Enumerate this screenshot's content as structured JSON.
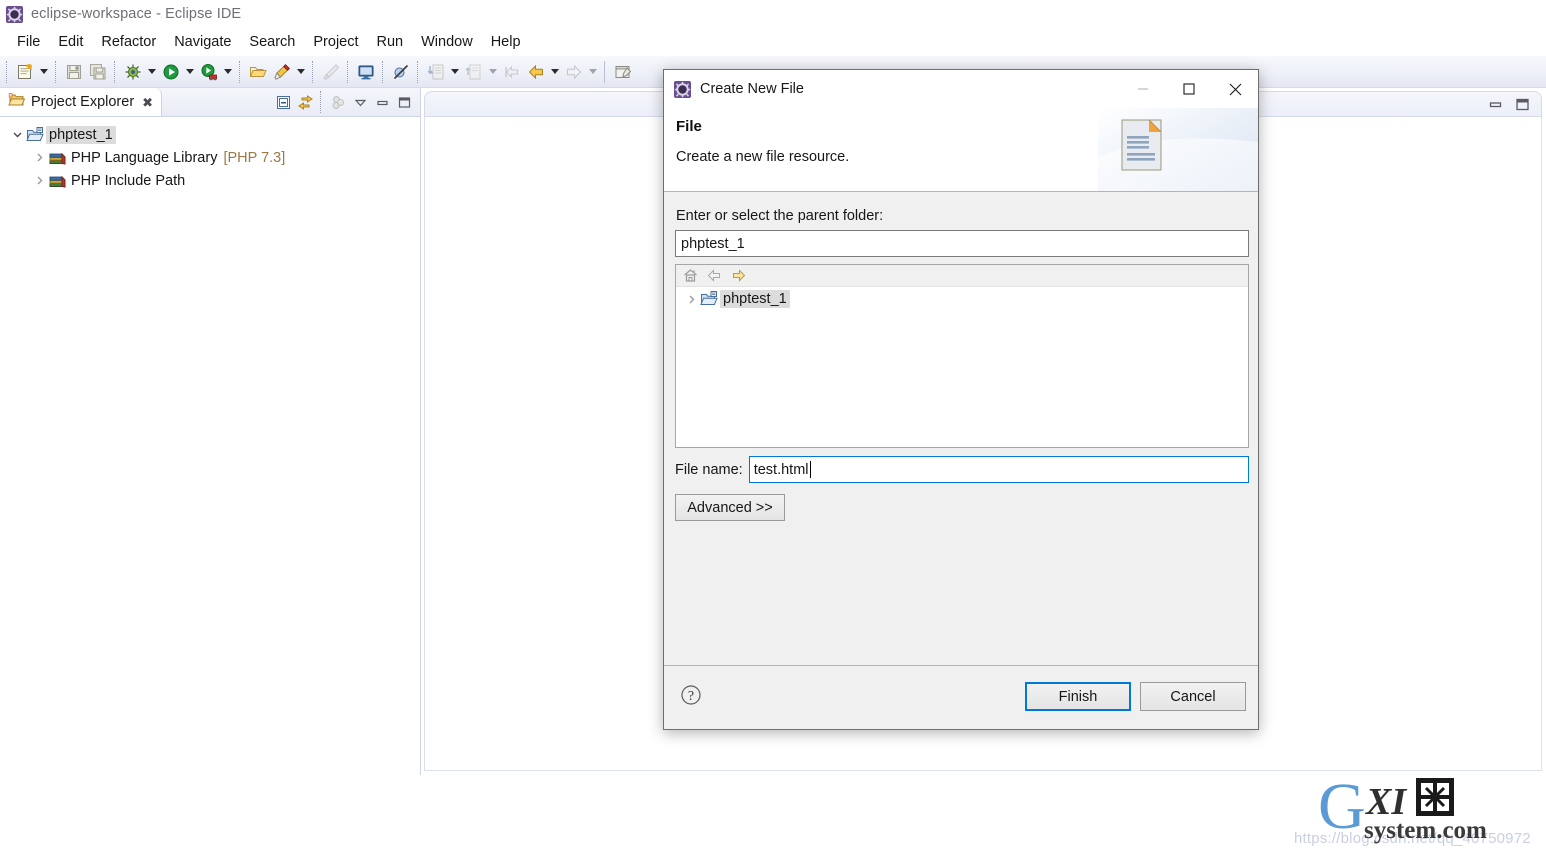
{
  "window": {
    "title": "eclipse-workspace - Eclipse IDE",
    "app_icon": "eclipse-icon"
  },
  "menubar": {
    "items": [
      {
        "label": "File"
      },
      {
        "label": "Edit"
      },
      {
        "label": "Refactor"
      },
      {
        "label": "Navigate"
      },
      {
        "label": "Search"
      },
      {
        "label": "Project"
      },
      {
        "label": "Run"
      },
      {
        "label": "Window"
      },
      {
        "label": "Help"
      }
    ]
  },
  "toolbar": {
    "groups": [
      {
        "icons": [
          "new-file-icon"
        ],
        "has_arrow": true
      },
      {
        "icons": [
          "save-icon",
          "save-all-icon"
        ],
        "has_arrow": false
      },
      {
        "icons": [
          "debug-icon"
        ],
        "has_arrow": true
      },
      {
        "icons": [
          "run-icon"
        ],
        "has_arrow": true
      },
      {
        "icons": [
          "profile-icon"
        ],
        "has_arrow": true
      },
      {
        "icons": [
          "open-folder-icon",
          "highlight-pen-icon"
        ],
        "has_arrow": true
      },
      {
        "icons": [
          "brush-icon"
        ],
        "has_arrow": false
      },
      {
        "icons": [
          "terminal-icon"
        ],
        "has_arrow": false
      },
      {
        "icons": [
          "skip-breakpoints-icon"
        ],
        "has_arrow": false
      },
      {
        "icons": [
          "step-into-icon"
        ],
        "has_arrow": true
      },
      {
        "icons": [
          "step-return-icon"
        ],
        "has_arrow": true
      },
      {
        "icons": [
          "back-prev-icon"
        ],
        "has_arrow": false
      },
      {
        "icons": [
          "back-icon"
        ],
        "has_arrow": true
      },
      {
        "icons": [
          "forward-icon"
        ],
        "has_arrow": true
      },
      {
        "icons": [
          "new-editor-icon"
        ],
        "has_arrow": false
      }
    ]
  },
  "project_explorer": {
    "tab_label": "Project Explorer",
    "close_glyph": "✖",
    "view_icons": [
      "collapse-all-icon",
      "link-with-editor-icon",
      "view-menu-filter-icon",
      "view-menu-icon",
      "minimize-icon",
      "maximize-icon"
    ],
    "tree": [
      {
        "label": "phptest_1",
        "icon": "php-project-icon",
        "expanded": true,
        "selected": true,
        "suffix": ""
      },
      {
        "label": "PHP Language Library",
        "icon": "php-library-icon",
        "expanded": false,
        "selected": false,
        "suffix": "[PHP 7.3]"
      },
      {
        "label": "PHP Include Path",
        "icon": "php-library-icon",
        "expanded": false,
        "selected": false,
        "suffix": ""
      }
    ]
  },
  "editor_area": {
    "minimize_icon": "minimize-icon",
    "maximize_icon": "maximize-icon"
  },
  "dialog": {
    "title": "Create New File",
    "title_icon": "eclipse-icon",
    "window_buttons": {
      "minimize": "—",
      "maximize": "☐",
      "close": "✕"
    },
    "header": {
      "heading": "File",
      "description": "Create a new file resource.",
      "art_icon": "document-page-icon"
    },
    "parent_folder": {
      "label": "Enter or select the parent folder:",
      "value": "phptest_1",
      "placeholder": ""
    },
    "tree_toolbar_icons": [
      "home-icon",
      "back-icon",
      "forward-icon"
    ],
    "folder_tree": [
      {
        "label": "phptest_1",
        "icon": "php-project-icon",
        "expanded": false,
        "selected": true
      }
    ],
    "file_name": {
      "label": "File name:",
      "value": "test.html",
      "placeholder": ""
    },
    "advanced_button": "Advanced >>",
    "help_icon": "help-question-icon",
    "finish_button": "Finish",
    "cancel_button": "Cancel"
  },
  "watermark": {
    "logo_g": "G",
    "logo_xi": "XI",
    "logo_cn": "网",
    "logo_sub": "system.com",
    "url_text": "https://blog.csdn.net/qq_40750972"
  },
  "colors": {
    "accent_blue": "#0078d7",
    "toolbar_bg": "#eef0f8",
    "dialog_bg": "#f0f0f0",
    "selection_gray": "#dcdcdc",
    "library_brown": "#9a7a45",
    "watermark_blue": "#5b9bd5"
  }
}
